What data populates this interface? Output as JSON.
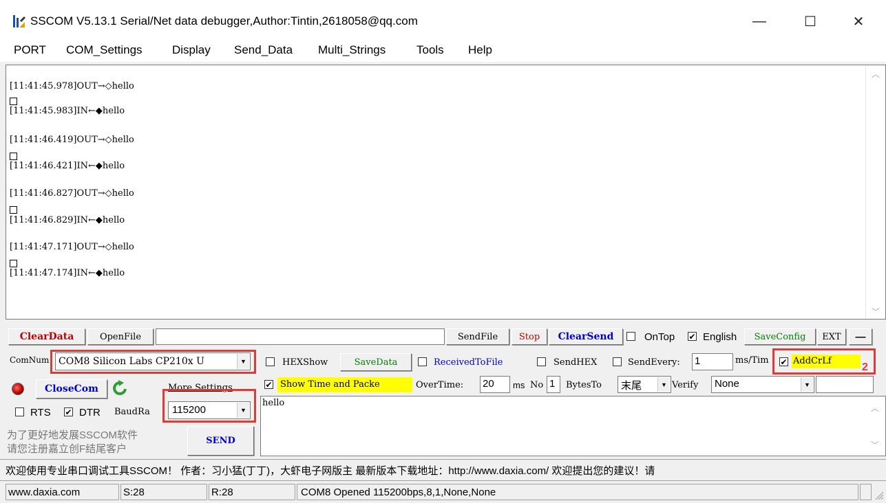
{
  "window": {
    "title": "SSCOM V5.13.1 Serial/Net data debugger,Author:Tintin,2618058@qq.com",
    "minimize": "—",
    "maximize": "☐",
    "close": "✕"
  },
  "menu": [
    "PORT",
    "COM_Settings",
    "Display",
    "Send_Data",
    "Multi_Strings",
    "Tools",
    "Help"
  ],
  "log": [
    "[11:41:45.978]OUT→◇hello",
    "[11:41:45.983]IN←◆hello",
    "[11:41:46.419]OUT→◇hello",
    "[11:41:46.421]IN←◆hello",
    "[11:41:46.827]OUT→◇hello",
    "[11:41:46.829]IN←◆hello",
    "[11:41:47.171]OUT→◇hello",
    "[11:41:47.174]IN←◆hello"
  ],
  "toolbar": {
    "clear_data": "ClearData",
    "open_file": "OpenFile",
    "file_path": "",
    "send_file": "SendFile",
    "stop": "Stop",
    "clear_send": "ClearSend",
    "on_top": "OnTop",
    "on_top_checked": false,
    "english": "English",
    "english_checked": true,
    "save_config": "SaveConfig",
    "ext": "EXT",
    "collapse": "—"
  },
  "settings": {
    "com_num_label": "ComNum",
    "com_num_value": "COM8 Silicon Labs CP210x U",
    "close_com": "CloseCom",
    "more_settings": "More Settings",
    "rts": "RTS",
    "rts_checked": false,
    "dtr": "DTR",
    "dtr_checked": true,
    "baud_label": "BaudRa",
    "baud_value": "115200",
    "hex_show": "HEXShow",
    "save_data": "SaveData",
    "received_to_file": "ReceivedToFile",
    "send_hex": "SendHEX",
    "send_every": "SendEvery:",
    "send_every_value": "1",
    "ms_tim": "ms/Tim",
    "add_crlf": "AddCrLf",
    "add_crlf_checked": true,
    "show_time": "Show Time and Packe",
    "show_time_checked": true,
    "overtime_label": "OverTime:",
    "overtime_value": "20",
    "ms": "ms",
    "no_label": "No",
    "no_value": "1",
    "bytes_to": "BytesTo",
    "bytes_to_value": "末尾",
    "verify_label": "Verify",
    "verify_value": "None",
    "send_text": "hello",
    "promo_line1": "为了更好地发展SSCOM软件",
    "promo_line2": "请您注册嘉立创F结尾客户",
    "send_button": "SEND",
    "annotation_number": "2"
  },
  "banner": "欢迎使用专业串口调试工具SSCOM！  作者：习小猛(丁丁)，大虾电子网版主  最新版本下载地址：http://www.daxia.com/  欢迎提出您的建议！请",
  "status": {
    "site": "www.daxia.com",
    "sent": "S:28",
    "received": "R:28",
    "port_status": "COM8 Opened  115200bps,8,1,None,None"
  },
  "colors": {
    "accent_red": "#e53935",
    "highlight_yellow": "#ffff00",
    "clear_red": "#c00000",
    "send_blue": "#0000cc",
    "save_green": "#008000"
  }
}
